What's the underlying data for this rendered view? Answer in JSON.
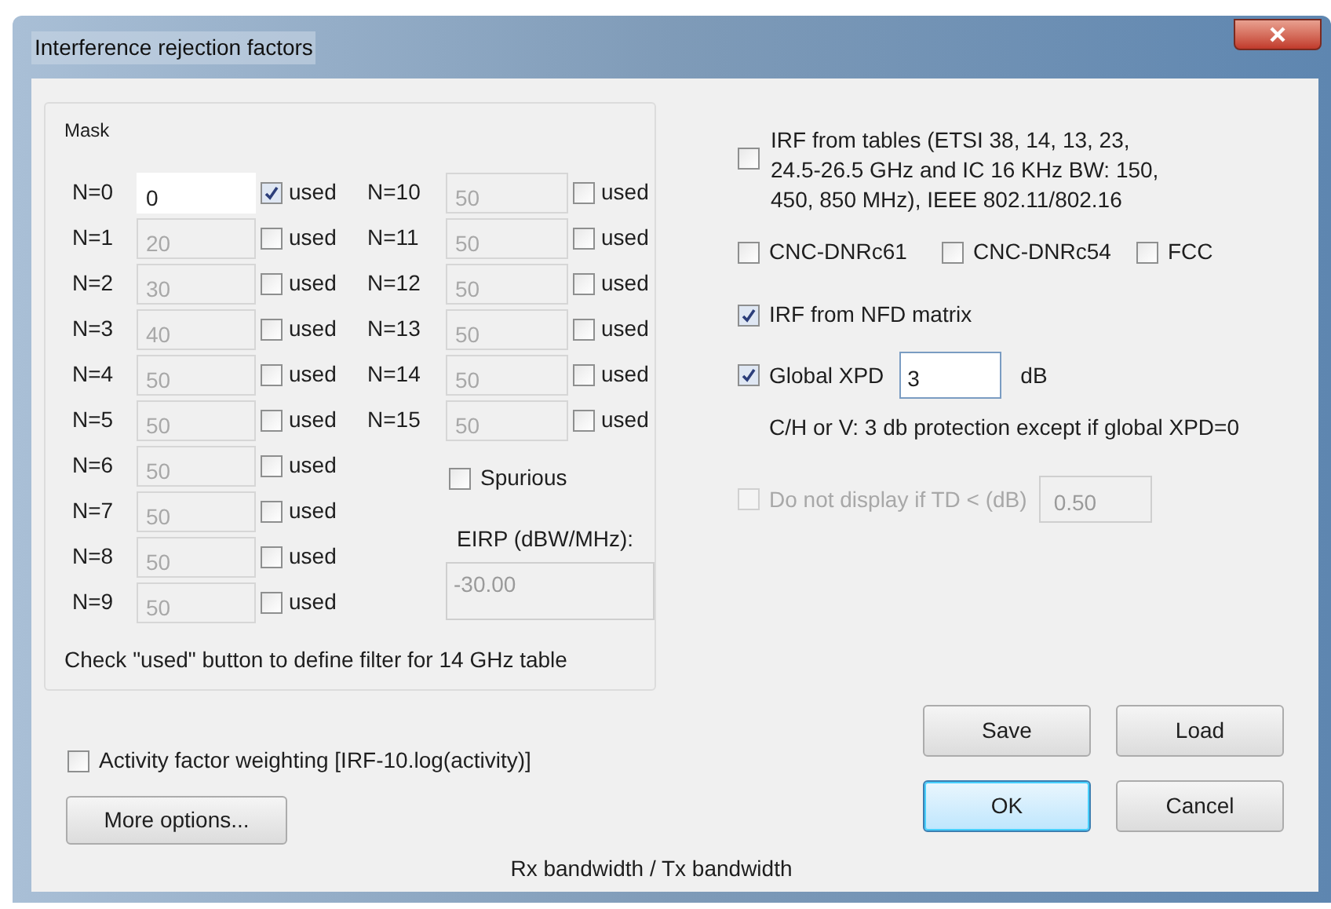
{
  "window": {
    "title": "Interference rejection factors"
  },
  "mask": {
    "title": "Mask",
    "rows": [
      {
        "label": "N=0",
        "value": "0",
        "checked": true,
        "disabled": false,
        "check_label": "used"
      },
      {
        "label": "N=1",
        "value": "20",
        "checked": false,
        "disabled": true,
        "check_label": "used"
      },
      {
        "label": "N=2",
        "value": "30",
        "checked": false,
        "disabled": true,
        "check_label": "used"
      },
      {
        "label": "N=3",
        "value": "40",
        "checked": false,
        "disabled": true,
        "check_label": "used"
      },
      {
        "label": "N=4",
        "value": "50",
        "checked": false,
        "disabled": true,
        "check_label": "used"
      },
      {
        "label": "N=5",
        "value": "50",
        "checked": false,
        "disabled": true,
        "check_label": "used"
      },
      {
        "label": "N=6",
        "value": "50",
        "checked": false,
        "disabled": true,
        "check_label": "used"
      },
      {
        "label": "N=7",
        "value": "50",
        "checked": false,
        "disabled": true,
        "check_label": "used"
      },
      {
        "label": "N=8",
        "value": "50",
        "checked": false,
        "disabled": true,
        "check_label": "used"
      },
      {
        "label": "N=9",
        "value": "50",
        "checked": false,
        "disabled": true,
        "check_label": "used"
      },
      {
        "label": "N=10",
        "value": "50",
        "checked": false,
        "disabled": true,
        "check_label": "used"
      },
      {
        "label": "N=11",
        "value": "50",
        "checked": false,
        "disabled": true,
        "check_label": "used"
      },
      {
        "label": "N=12",
        "value": "50",
        "checked": false,
        "disabled": true,
        "check_label": "used"
      },
      {
        "label": "N=13",
        "value": "50",
        "checked": false,
        "disabled": true,
        "check_label": "used"
      },
      {
        "label": "N=14",
        "value": "50",
        "checked": false,
        "disabled": true,
        "check_label": "used"
      },
      {
        "label": "N=15",
        "value": "50",
        "checked": false,
        "disabled": true,
        "check_label": "used"
      }
    ],
    "spurious": {
      "label": "Spurious",
      "checked": false
    },
    "eirp": {
      "label": "EIRP (dBW/MHz):",
      "value": "-30.00",
      "disabled": true
    },
    "note": "Check \"used\" button to define filter for 14 GHz table"
  },
  "options": {
    "irf_tables": {
      "lines": [
        "IRF from tables (ETSI 38, 14, 13, 23,",
        "24.5-26.5 GHz and IC 16 KHz BW: 150,",
        "450, 850 MHz), IEEE 802.11/802.16"
      ],
      "checked": false
    },
    "standards": [
      {
        "label": "CNC-DNRc61",
        "checked": false
      },
      {
        "label": "CNC-DNRc54",
        "checked": false
      },
      {
        "label": "FCC",
        "checked": false
      }
    ],
    "nfd": {
      "label": "IRF from NFD matrix",
      "checked": true
    },
    "global_xpd": {
      "label": "Global XPD",
      "checked": true,
      "value": "3",
      "unit": "dB"
    },
    "xpd_note": "C/H or V: 3 db protection except if global XPD=0",
    "do_not_display": {
      "label": "Do not display if TD < (dB)",
      "checked": false,
      "disabled": true,
      "value": "0.50"
    }
  },
  "activity": {
    "label": "Activity factor weighting [IRF-10.log(activity)]",
    "checked": false
  },
  "more_options": "More options...",
  "buttons": [
    {
      "label": "Save",
      "default": false
    },
    {
      "label": "Load",
      "default": false
    },
    {
      "label": "OK",
      "default": true
    },
    {
      "label": "Cancel",
      "default": false
    }
  ],
  "footer": "Rx bandwidth / Tx bandwidth"
}
